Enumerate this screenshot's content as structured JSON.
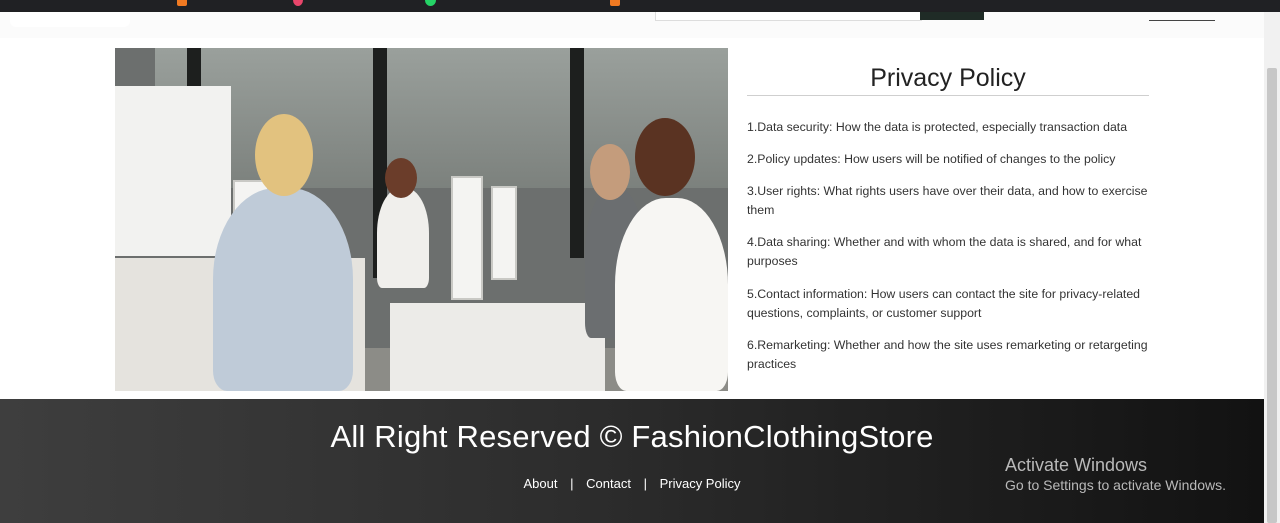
{
  "policy": {
    "title": "Privacy Policy",
    "items": [
      "1.Data security: How the data is protected, especially transaction data",
      "2.Policy updates: How users will be notified of changes to the policy",
      "3.User rights: What rights users have over their data, and how to exercise them",
      "4.Data sharing: Whether and with whom the data is shared, and for what purposes",
      "5.Contact information: How users can contact the site for privacy-related questions, complaints, or customer support",
      "6.Remarketing: Whether and how the site uses remarketing or retargeting practices"
    ]
  },
  "footer": {
    "copyright": "All Right Reserved © FashionClothingStore",
    "links": [
      "About",
      "Contact",
      "Privacy Policy"
    ],
    "separator": "|"
  },
  "os_watermark": {
    "line1": "Activate Windows",
    "line2": "Go to Settings to activate Windows."
  },
  "colors": {
    "footer_bg": "#2d2d2d",
    "page_bg": "#ffffff"
  }
}
